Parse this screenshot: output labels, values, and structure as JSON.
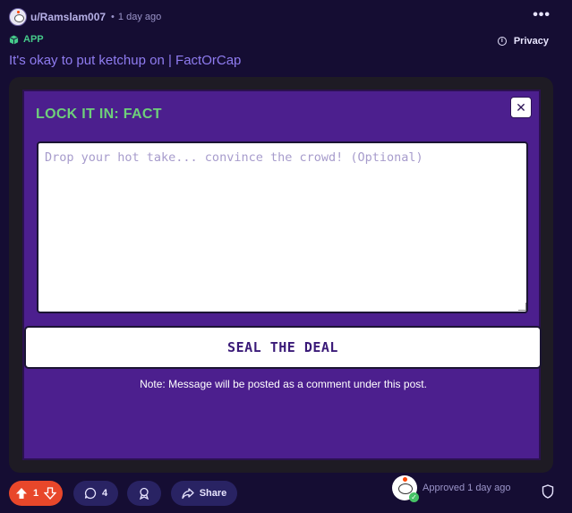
{
  "post": {
    "username": "u/Ramslam007",
    "separator": "•",
    "timestamp": "1 day ago",
    "more_label": "•••",
    "app_label": "APP",
    "privacy_label": "Privacy",
    "title": "It's okay to put ketchup on | FactOrCap"
  },
  "game": {
    "heading": "LOCK IT IN: FACT",
    "close_label": "✕",
    "input_placeholder": "Drop your hot take... convince the crowd! (Optional)",
    "submit_label": "SEAL THE DEAL",
    "note": "Note: Message will be posted as a comment under this post."
  },
  "actions": {
    "vote_count": "1",
    "comment_count": "4",
    "share_label": "Share",
    "approved_text": "Approved 1 day ago"
  },
  "colors": {
    "background": "#150d33",
    "panel": "#4c1f8e",
    "heading_green": "#6ed07a",
    "title_purple": "#8f7cf0",
    "upvote_orange": "#e8472a"
  }
}
